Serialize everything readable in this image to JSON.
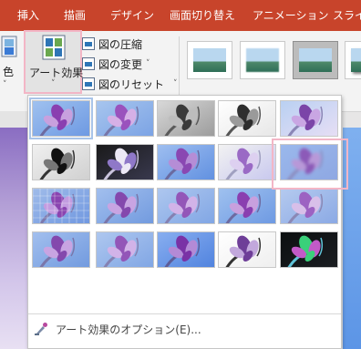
{
  "tabs": [
    "挿入",
    "描画",
    "デザイン",
    "画面切り替え",
    "アニメーション",
    "スライド"
  ],
  "ribbon": {
    "color_label_fragment": "色",
    "art_effects_label": "アート効果",
    "art_effects_chevron": "˅",
    "commands": [
      {
        "label": "図の圧縮",
        "chevron": ""
      },
      {
        "label": "図の変更",
        "chevron": "˅"
      },
      {
        "label": "図のリセット",
        "chevron": "˅"
      }
    ]
  },
  "picture_styles": [
    "plain-frame",
    "soft-edge",
    "selected-frame",
    "shadow-frame"
  ],
  "gallery": {
    "effects": [
      {
        "id": "none",
        "filter": "none"
      },
      {
        "id": "marker",
        "filter": "m"
      },
      {
        "id": "pencil-grayscale",
        "filter": "g"
      },
      {
        "id": "pencil-sketch",
        "filter": "s"
      },
      {
        "id": "line-drawing",
        "filter": "l"
      },
      {
        "id": "chalk-sketch",
        "filter": "c"
      },
      {
        "id": "paint-strokes",
        "filter": "d"
      },
      {
        "id": "paint-brush",
        "filter": "b"
      },
      {
        "id": "light-screen",
        "filter": "w"
      },
      {
        "id": "blur",
        "filter": "u"
      },
      {
        "id": "mosaic-bubbles",
        "filter": "q"
      },
      {
        "id": "glass",
        "filter": "e"
      },
      {
        "id": "cement",
        "filter": "t"
      },
      {
        "id": "texturizer",
        "filter": "r"
      },
      {
        "id": "crisscross-etching",
        "filter": "x"
      },
      {
        "id": "pastels-smooth",
        "filter": "e"
      },
      {
        "id": "plastic-wrap",
        "filter": "t"
      },
      {
        "id": "cutout",
        "filter": "h"
      },
      {
        "id": "photocopy",
        "filter": "p"
      },
      {
        "id": "glow-edges",
        "filter": "n"
      }
    ],
    "selected_index": 0,
    "highlighted_index": 9,
    "options_label": "アート効果のオプション(E)..."
  },
  "colors": {
    "tab_bar": "#c8442b",
    "highlight_pink": "#f3b6c6",
    "flower_purple": "#7a3fa0",
    "sky_blue": "#8fb3e6"
  }
}
